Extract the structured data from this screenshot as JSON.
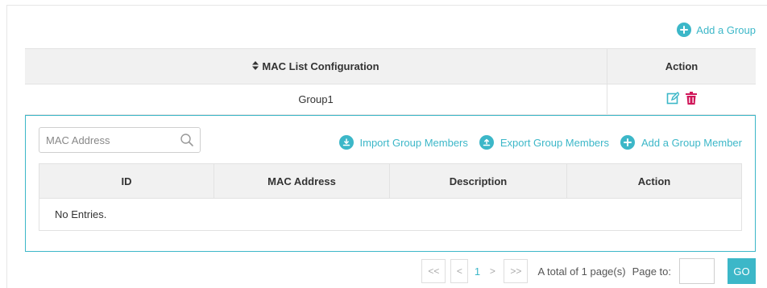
{
  "header": {
    "add_group_label": "Add a Group",
    "add_icon": "plus-circle-icon"
  },
  "outer_table": {
    "columns": [
      "MAC List Configuration",
      "Action"
    ],
    "sort_icon": "sort-icon",
    "rows": [
      {
        "group": "Group1",
        "actions": [
          "edit-icon",
          "delete-icon"
        ]
      }
    ]
  },
  "detail": {
    "search_placeholder": "MAC Address",
    "toolbar": {
      "import_label": "Import Group Members",
      "export_label": "Export Group Members",
      "add_member_label": "Add a Group Member"
    },
    "columns": [
      "ID",
      "MAC Address",
      "Description",
      "Action"
    ],
    "empty_text": "No Entries."
  },
  "pagination": {
    "first": "<<",
    "prev": "<",
    "current_page": "1",
    "next": ">",
    "last": ">>",
    "total_text": "A total of 1 page(s)",
    "page_to_label": "Page to:",
    "go_label": "GO"
  },
  "colors": {
    "accent": "#3cb7c8",
    "delete": "#d0175a",
    "header_bg": "#f1f1f1"
  }
}
